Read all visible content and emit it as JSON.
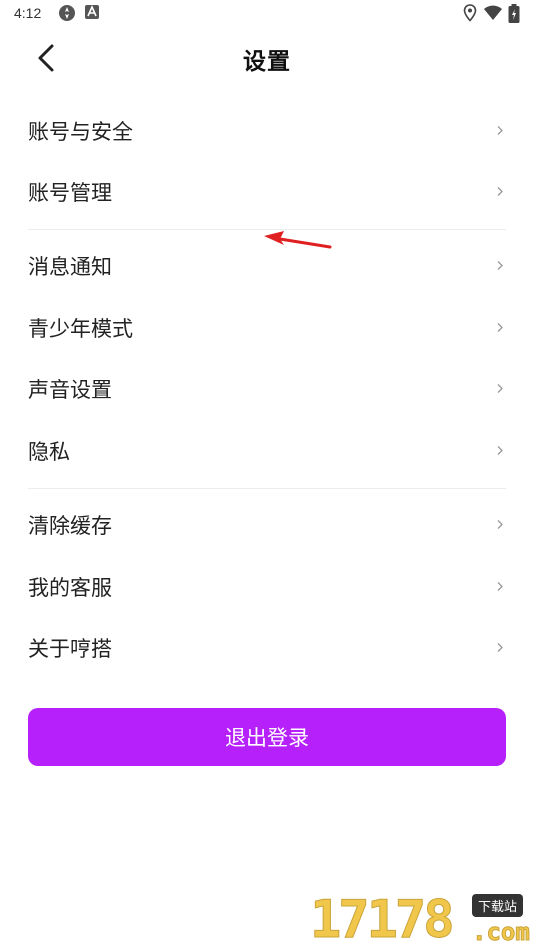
{
  "status_bar": {
    "time": "4:12",
    "left_icons": [
      "sync-icon",
      "a-icon"
    ],
    "right_icons": [
      "location-icon",
      "wifi-icon",
      "battery-icon"
    ]
  },
  "header": {
    "title": "设置",
    "back_icon": "chevron-left-icon"
  },
  "groups": [
    {
      "items": [
        {
          "label": "账号与安全"
        },
        {
          "label": "账号管理"
        }
      ]
    },
    {
      "items": [
        {
          "label": "消息通知"
        },
        {
          "label": "青少年模式"
        },
        {
          "label": "声音设置"
        },
        {
          "label": "隐私"
        }
      ]
    },
    {
      "items": [
        {
          "label": "清除缓存"
        },
        {
          "label": "我的客服"
        },
        {
          "label": "关于哼搭"
        }
      ]
    }
  ],
  "chevron_glyph": "›",
  "logout": {
    "label": "退出登录"
  },
  "colors": {
    "accent": "#b520fb",
    "divider": "#ececec",
    "annotation_arrow": "#e02020"
  },
  "watermark": {
    "digits": "17178",
    "badge": "下载站",
    "domain": ".com"
  }
}
